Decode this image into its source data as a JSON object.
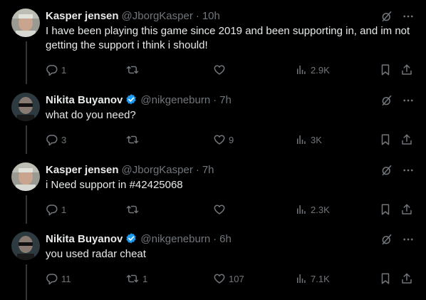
{
  "tweets": [
    {
      "name": "Kasper jensen",
      "handle": "@JborgKasper",
      "time": "10h",
      "verified": false,
      "text": "I have been playing this game since 2019 and been supporting in, and im not getting the support i think i should!",
      "replies": "1",
      "retweets": "",
      "likes": "",
      "views": "2.9K"
    },
    {
      "name": "Nikita Buyanov",
      "handle": "@nikgeneburn",
      "time": "7h",
      "verified": true,
      "text": "what do you need?",
      "replies": "3",
      "retweets": "",
      "likes": "9",
      "views": "3K"
    },
    {
      "name": "Kasper jensen",
      "handle": "@JborgKasper",
      "time": "7h",
      "verified": false,
      "text": "i Need support in #42425068",
      "replies": "1",
      "retweets": "",
      "likes": "",
      "views": "2.3K"
    },
    {
      "name": "Nikita Buyanov",
      "handle": "@nikgeneburn",
      "time": "6h",
      "verified": true,
      "text": "you used radar cheat",
      "replies": "11",
      "retweets": "1",
      "likes": "107",
      "views": "7.1K"
    }
  ],
  "separator": "·",
  "colors": {
    "background": "#000000",
    "text": "#e7e9ea",
    "muted": "#71767b",
    "verified": "#1d9bf0",
    "thread_line": "#333639"
  },
  "icons": [
    "grok-icon",
    "more-icon",
    "reply-icon",
    "retweet-icon",
    "like-icon",
    "views-icon",
    "bookmark-icon",
    "share-icon",
    "verified-badge-icon"
  ]
}
